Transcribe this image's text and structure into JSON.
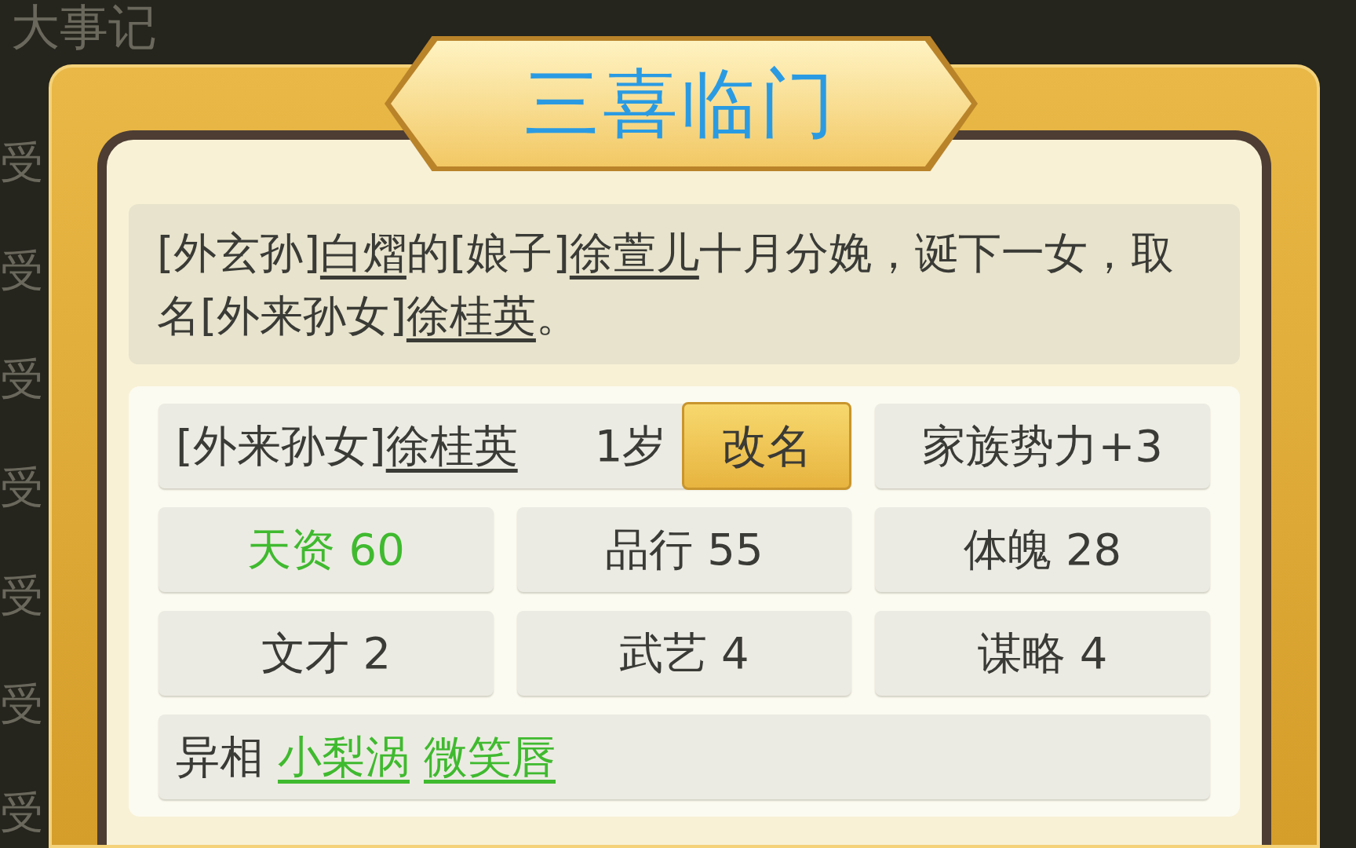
{
  "background": {
    "title": "大事记",
    "side_labels": [
      "受",
      "受",
      "受",
      "受",
      "受",
      "受",
      "受"
    ]
  },
  "dialog": {
    "title": "三喜临门",
    "message": [
      {
        "text": "[外玄孙]",
        "kind": "text"
      },
      {
        "text": "白熠",
        "kind": "link"
      },
      {
        "text": "的[娘子]",
        "kind": "text"
      },
      {
        "text": "徐萱儿",
        "kind": "link"
      },
      {
        "text": "十月分娩，诞下一女，取名[外来孙女]",
        "kind": "text"
      },
      {
        "text": "徐桂英",
        "kind": "link"
      },
      {
        "text": "。",
        "kind": "text"
      }
    ],
    "person": {
      "title": "[外来孙女]",
      "name": "徐桂英",
      "age": "1岁",
      "rename_button": "改名",
      "bonus": "家族势力+3"
    },
    "stats": [
      {
        "label": "天资 60",
        "highlight": true
      },
      {
        "label": "品行 55",
        "highlight": false
      },
      {
        "label": "体魄 28",
        "highlight": false
      },
      {
        "label": "文才 2",
        "highlight": false
      },
      {
        "label": "武艺 4",
        "highlight": false
      },
      {
        "label": "谋略 4",
        "highlight": false
      }
    ],
    "traits": {
      "label": "异相",
      "items": [
        "小梨涡",
        "微笑唇"
      ]
    }
  }
}
